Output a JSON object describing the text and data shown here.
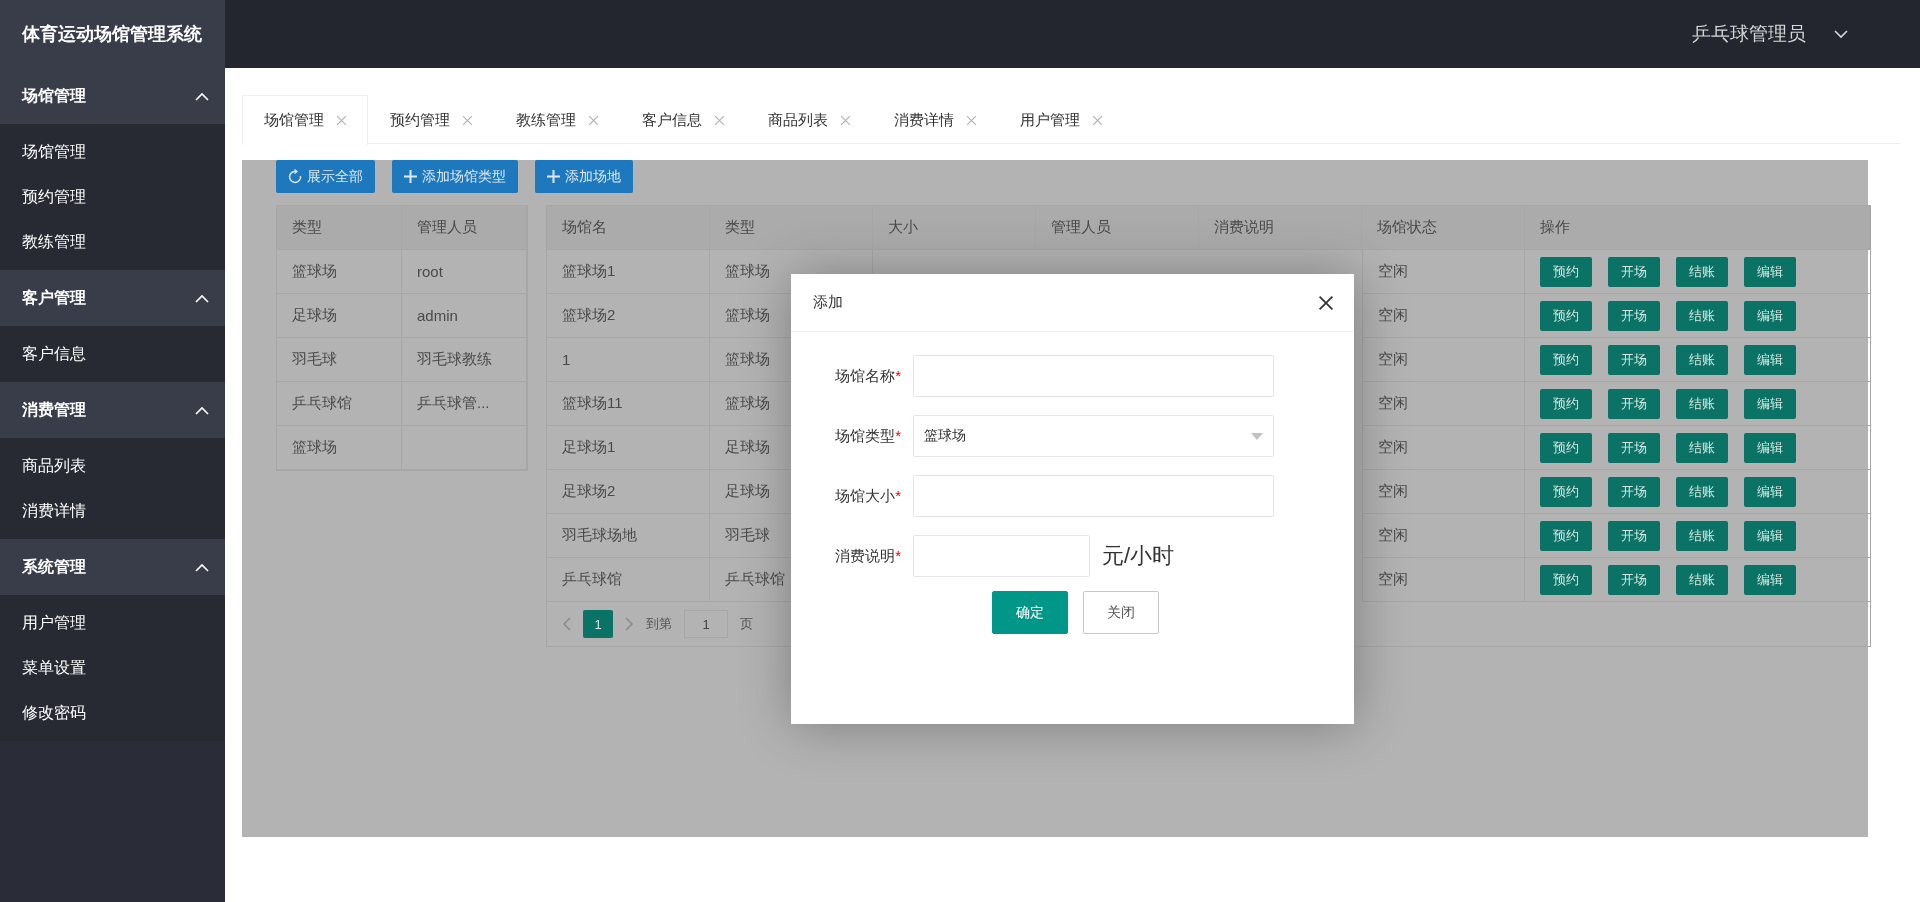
{
  "app_title": "体育运动场馆管理系统",
  "user": {
    "name": "乒乓球管理员"
  },
  "sidebar": [
    {
      "label": "场馆管理",
      "expanded": true,
      "items": [
        "场馆管理",
        "预约管理",
        "教练管理"
      ]
    },
    {
      "label": "客户管理",
      "expanded": true,
      "items": [
        "客户信息"
      ]
    },
    {
      "label": "消费管理",
      "expanded": true,
      "items": [
        "商品列表",
        "消费详情"
      ]
    },
    {
      "label": "系统管理",
      "expanded": true,
      "items": [
        "用户管理",
        "菜单设置",
        "修改密码"
      ]
    }
  ],
  "tabs": [
    {
      "label": "场馆管理",
      "selected": true
    },
    {
      "label": "预约管理",
      "selected": false
    },
    {
      "label": "教练管理",
      "selected": false
    },
    {
      "label": "客户信息",
      "selected": false
    },
    {
      "label": "商品列表",
      "selected": false
    },
    {
      "label": "消费详情",
      "selected": false
    },
    {
      "label": "用户管理",
      "selected": false
    }
  ],
  "toolbar": [
    {
      "label": "展示全部",
      "kind": "refresh"
    },
    {
      "label": "添加场馆类型",
      "kind": "add"
    },
    {
      "label": "添加场地",
      "kind": "add"
    }
  ],
  "type_table": {
    "columns": [
      "类型",
      "管理人员"
    ],
    "rows": [
      [
        "篮球场",
        "root"
      ],
      [
        "足球场",
        "admin"
      ],
      [
        "羽毛球",
        "羽毛球教练"
      ],
      [
        "乒乓球馆",
        "乒乓球管..."
      ],
      [
        "篮球场",
        null
      ]
    ]
  },
  "venue_table": {
    "columns": [
      "场馆名",
      "类型",
      "大小",
      "管理人员",
      "消费说明",
      "场馆状态",
      "操作"
    ],
    "rows": [
      {
        "cells": [
          "篮球场1",
          "篮球场",
          null,
          null,
          null,
          "空闲"
        ],
        "actions": [
          "预约",
          "开场",
          "结账",
          "编辑"
        ]
      },
      {
        "cells": [
          "篮球场2",
          "篮球场",
          null,
          null,
          null,
          "空闲"
        ],
        "actions": [
          "预约",
          "开场",
          "结账",
          "编辑"
        ]
      },
      {
        "cells": [
          "1",
          "篮球场",
          null,
          null,
          null,
          "空闲"
        ],
        "actions": [
          "预约",
          "开场",
          "结账",
          "编辑"
        ]
      },
      {
        "cells": [
          "篮球场11",
          "篮球场",
          null,
          null,
          null,
          "空闲"
        ],
        "actions": [
          "预约",
          "开场",
          "结账",
          "编辑"
        ]
      },
      {
        "cells": [
          "足球场1",
          "足球场",
          null,
          null,
          null,
          "空闲"
        ],
        "actions": [
          "预约",
          "开场",
          "结账",
          "编辑"
        ]
      },
      {
        "cells": [
          "足球场2",
          "足球场",
          null,
          null,
          null,
          "空闲"
        ],
        "actions": [
          "预约",
          "开场",
          "结账",
          "编辑"
        ]
      },
      {
        "cells": [
          "羽毛球场地",
          "羽毛球",
          null,
          null,
          null,
          "空闲"
        ],
        "actions": [
          "预约",
          "开场",
          "结账",
          "编辑"
        ]
      },
      {
        "cells": [
          "乒乓球馆",
          "乒乓球馆",
          null,
          null,
          null,
          "空闲"
        ],
        "actions": [
          "预约",
          "开场",
          "结账",
          "编辑"
        ]
      }
    ],
    "pagination": {
      "pages": [
        {
          "label": "1",
          "selected": true
        }
      ],
      "goto_label": "到第",
      "page_value": "1",
      "page_unit": "页"
    }
  },
  "modal": {
    "title": "添加",
    "fields": [
      {
        "label": "场馆名称",
        "required_mark": "*",
        "kind": "text"
      },
      {
        "label": "场馆类型",
        "required_mark": "*",
        "kind": "select",
        "value": "篮球场"
      },
      {
        "label": "场馆大小",
        "required_mark": "*",
        "kind": "text"
      },
      {
        "label": "消费说明",
        "required_mark": "*",
        "kind": "text",
        "suffix": "元/小时"
      }
    ],
    "buttons": [
      {
        "label": "确定",
        "kind": "primary"
      },
      {
        "label": "关闭",
        "kind": "default"
      }
    ]
  }
}
